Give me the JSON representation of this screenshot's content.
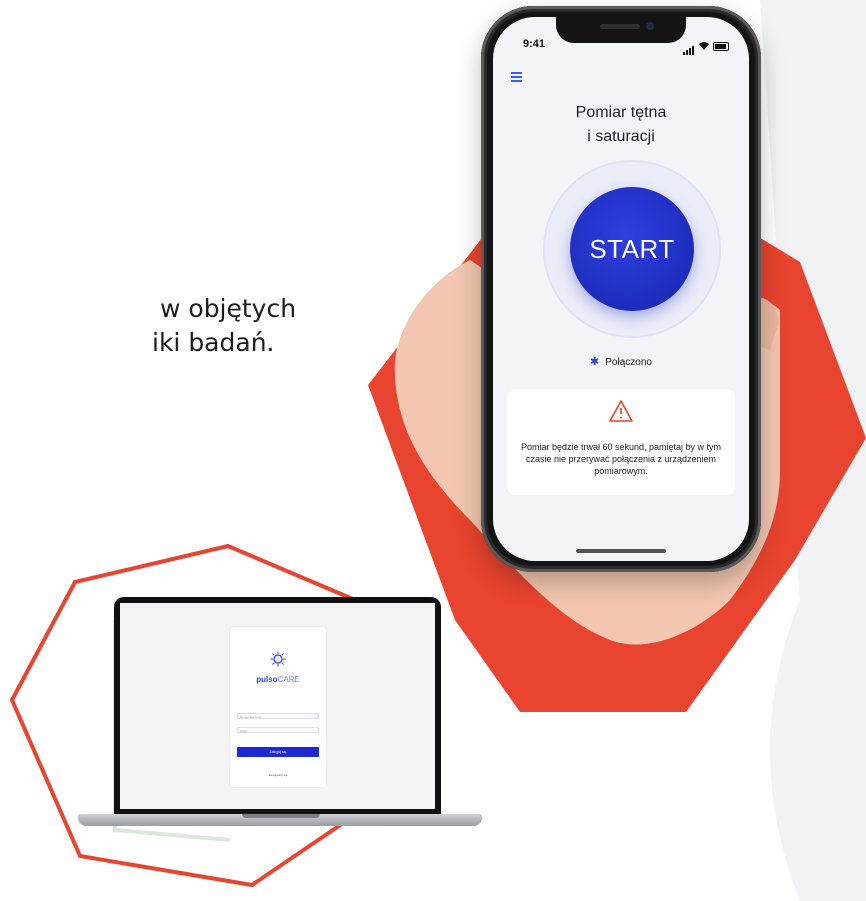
{
  "colors": {
    "accent_red": "#e8442f",
    "primary_blue": "#1e2dbd",
    "light_gray_bg": "#f1f2f4"
  },
  "side_text": {
    "line1": "w objętych",
    "line2": "iki badań."
  },
  "phone": {
    "status_time": "9:41",
    "title_line1": "Pomiar tętna",
    "title_line2": "i saturacji",
    "start_label": "START",
    "connection_status": "Połączono",
    "warning_text": "Pomiar będzie trwał 60 sekund, pamiętaj by w tym czasie nie przerywać połączenia z urządzeniem pomiarowym."
  },
  "laptop": {
    "brand_part1": "pulso",
    "brand_part2": "CARE",
    "phone_field_placeholder": "Numer telefonu",
    "password_field_placeholder": "Hasło",
    "login_button": "Zaloguj się",
    "register_link": "Zarejestruj się"
  }
}
